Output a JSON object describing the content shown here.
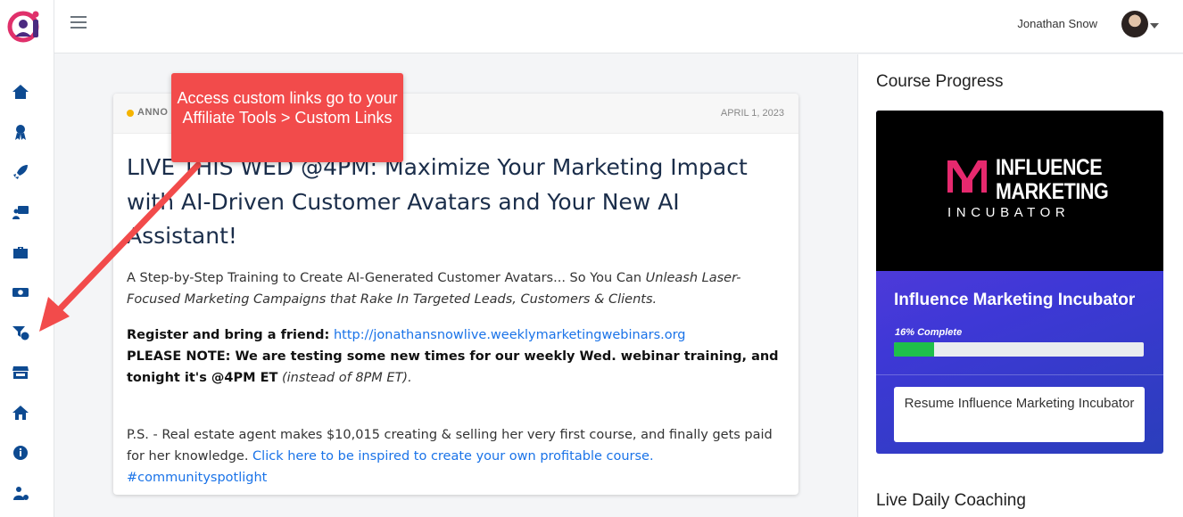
{
  "header": {
    "user_name": "Jonathan Snow"
  },
  "sidebar": {
    "items": [
      {
        "icon": "home-icon"
      },
      {
        "icon": "award-icon"
      },
      {
        "icon": "rocket-icon"
      },
      {
        "icon": "presentation-icon"
      },
      {
        "icon": "briefcase-icon"
      },
      {
        "icon": "money-icon"
      },
      {
        "icon": "funnel-dollar-icon"
      },
      {
        "icon": "store-icon"
      },
      {
        "icon": "house-icon"
      },
      {
        "icon": "info-icon"
      },
      {
        "icon": "user-info-icon"
      }
    ]
  },
  "callout": {
    "text": "Access custom links go to your Affiliate Tools > Custom Links"
  },
  "post": {
    "badge": "ANNO",
    "date": "APRIL 1, 2023",
    "title": "LIVE THIS WED @4PM: Maximize Your Marketing Impact with AI-Driven Customer Avatars and Your New AI Assistant!",
    "intro_plain": "A Step-by-Step Training to Create AI-Generated Customer Avatars... So You Can ",
    "intro_italic": "Unleash Laser-Focused Marketing Campaigns that Rake In Targeted Leads, Customers & Clients.",
    "register_label": "Register and bring a friend:",
    "register_link": "http://jonathansnowlive.weeklymarketingwebinars.org",
    "note_bold": "PLEASE NOTE: We are testing some new times for our weekly Wed. webinar training, and tonight it's @4PM ET",
    "note_italic": "(instead of 8PM ET).",
    "ps_plain": "P.S. - Real estate agent makes $10,015 creating & selling her very first course, and finally gets paid for her knowledge.",
    "ps_link": "Click here to be inspired to create your own profitable course. #communityspotlight"
  },
  "right_panel": {
    "title": "Course Progress",
    "course": {
      "logo_line1": "INFLUENCE",
      "logo_line2": "MARKETING",
      "logo_line3": "INCUBATOR",
      "name": "Influence Marketing Incubator",
      "progress_label": "16% Complete",
      "progress": 0.16,
      "resume_label": "Resume Influence Marketing Incubator"
    },
    "section2_title": "Live Daily Coaching"
  },
  "colors": {
    "accent": "#0d4a91",
    "callout": "#f24b4b",
    "progress": "#1fbf4b",
    "link": "#1a73e8"
  }
}
